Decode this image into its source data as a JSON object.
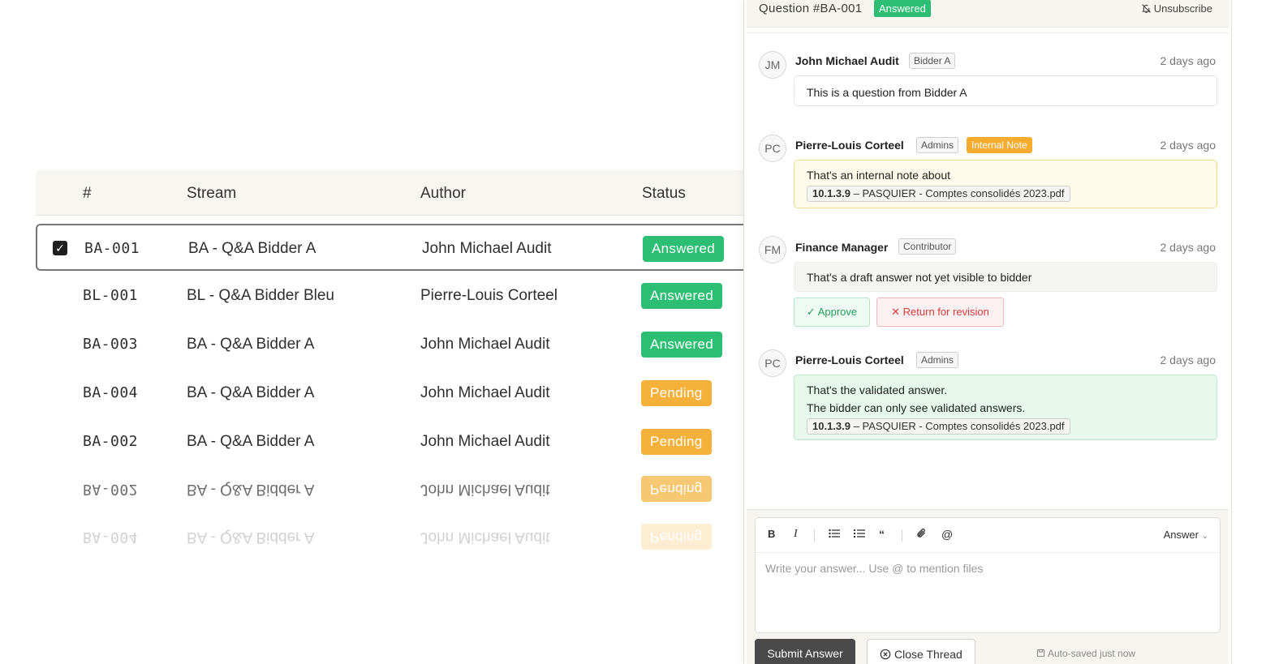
{
  "table": {
    "headers": {
      "num": "#",
      "stream": "Stream",
      "author": "Author",
      "status": "Status"
    },
    "rows": [
      {
        "id": "BA-001",
        "stream": "BA - Q&A Bidder A",
        "author": "John Michael Audit",
        "status": "Answered",
        "selected": true
      },
      {
        "id": "BL-001",
        "stream": "BL - Q&A Bidder Bleu",
        "author": "Pierre-Louis Corteel",
        "status": "Answered"
      },
      {
        "id": "BA-003",
        "stream": "BA - Q&A Bidder A",
        "author": "John Michael Audit",
        "status": "Answered"
      },
      {
        "id": "BA-004",
        "stream": "BA - Q&A Bidder A",
        "author": "John Michael Audit",
        "status": "Pending"
      },
      {
        "id": "BA-002",
        "stream": "BA - Q&A Bidder A",
        "author": "John Michael Audit",
        "status": "Pending"
      }
    ],
    "reflections": [
      {
        "id": "BA-002",
        "stream": "BA - Q&A Bidder A",
        "author": "John Michael Audit",
        "status": "Pending"
      },
      {
        "id": "BA-004",
        "stream": "BA - Q&A Bidder A",
        "author": "John Michael Audit",
        "status": "Pending"
      }
    ]
  },
  "panel": {
    "title": "Question #BA-001",
    "status": "Answered",
    "unsubscribe": "Unsubscribe",
    "messages": [
      {
        "initials": "JM",
        "name": "John Michael Audit",
        "tag": "Bidder A",
        "time": "2 days ago",
        "text": "This is a question from Bidder A"
      },
      {
        "initials": "PC",
        "name": "Pierre-Louis Corteel",
        "tag": "Admins",
        "tag2": "Internal Note",
        "time": "2 days ago",
        "text": "That's an internal note about",
        "file_code": "10.1.3.9",
        "file_sep": "–",
        "file_name": "PASQUIER - Comptes consolidés 2023.pdf"
      },
      {
        "initials": "FM",
        "name": "Finance Manager",
        "tag": "Contributor",
        "time": "2 days ago",
        "text": "That's a draft answer not yet visible to bidder",
        "approve": "Approve",
        "return": "Return for revision"
      },
      {
        "initials": "PC",
        "name": "Pierre-Louis Corteel",
        "tag": "Admins",
        "time": "2 days ago",
        "text_line1": "That's the validated answer.",
        "text_line2": "The bidder can only see validated answers.",
        "file_code": "10.1.3.9",
        "file_sep": "–",
        "file_name": "PASQUIER - Comptes consolidés 2023.pdf"
      }
    ],
    "composer": {
      "mode": "Answer",
      "placeholder": "Write your answer... Use @ to mention files",
      "submit": "Submit Answer",
      "close": "Close Thread",
      "autosave": "Auto-saved just now"
    }
  },
  "colors": {
    "answered": "#2cbf73",
    "pending": "#f5b13a",
    "internal": "#f6ac2f"
  }
}
